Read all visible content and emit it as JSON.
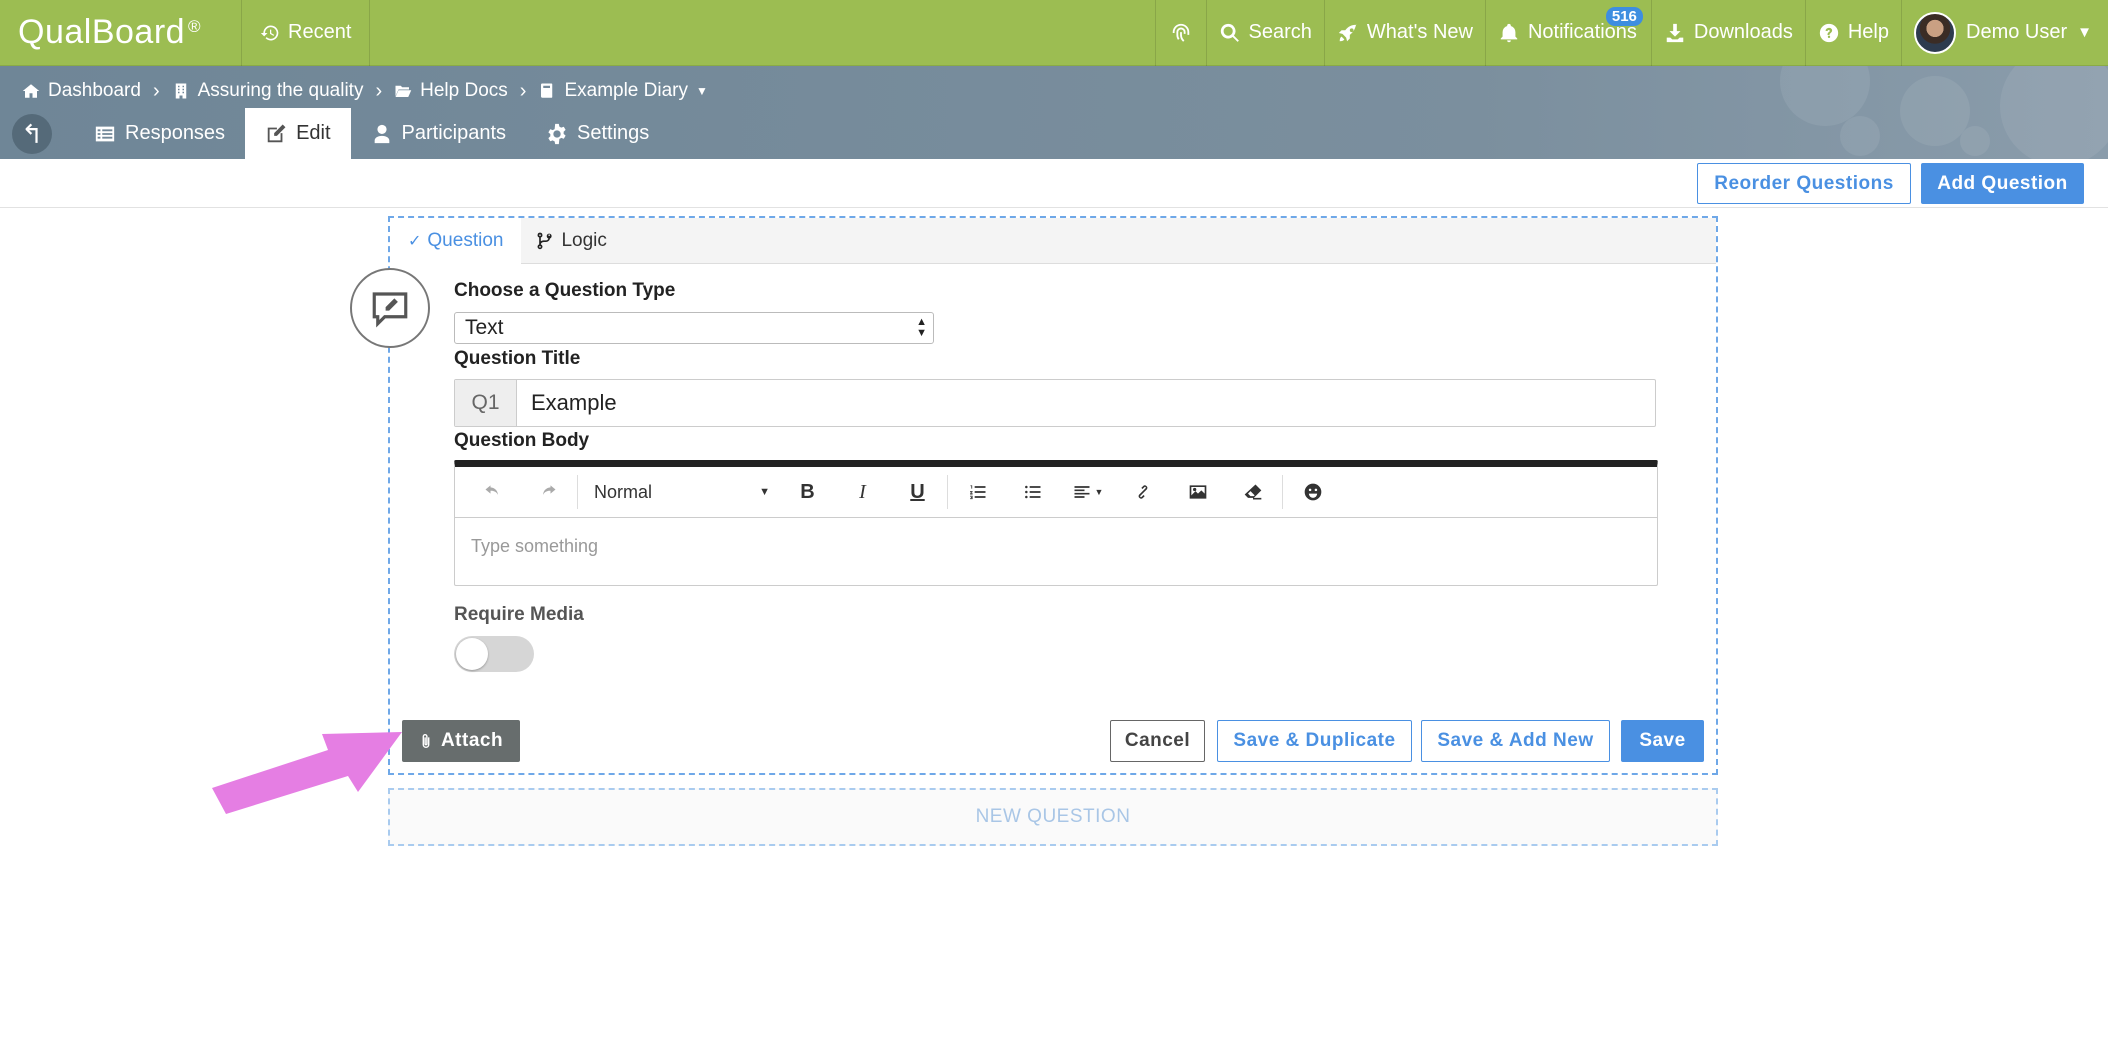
{
  "app": {
    "brand": "QualBoard",
    "brand_mark": "®",
    "recent_label": "Recent"
  },
  "topnav": {
    "search_label": "Search",
    "whats_new_label": "What's New",
    "notifications_label": "Notifications",
    "notifications_count": "516",
    "downloads_label": "Downloads",
    "help_label": "Help",
    "user_name": "Demo User"
  },
  "breadcrumb": {
    "items": [
      "Dashboard",
      "Assuring the quality",
      "Help Docs",
      "Example Diary"
    ]
  },
  "tabs": {
    "responses": "Responses",
    "edit": "Edit",
    "participants": "Participants",
    "settings": "Settings"
  },
  "actions": {
    "reorder": "Reorder Questions",
    "add": "Add Question"
  },
  "question": {
    "tab_question": "Question",
    "tab_logic": "Logic",
    "type_label": "Choose a Question Type",
    "type_value": "Text",
    "title_label": "Question Title",
    "title_prefix": "Q1",
    "title_value": "Example",
    "body_label": "Question Body",
    "format_value": "Normal",
    "body_placeholder": "Type something",
    "require_media_label": "Require Media",
    "require_media_on": false
  },
  "footer_buttons": {
    "attach": "Attach",
    "cancel": "Cancel",
    "save_duplicate": "Save & Duplicate",
    "save_add_new": "Save & Add New",
    "save": "Save"
  },
  "new_question_label": "NEW QUESTION",
  "colors": {
    "topbar": "#9cbd52",
    "subbar": "#7b8f9e",
    "accent": "#4a90e2",
    "annotation_arrow": "#e57ee3"
  }
}
